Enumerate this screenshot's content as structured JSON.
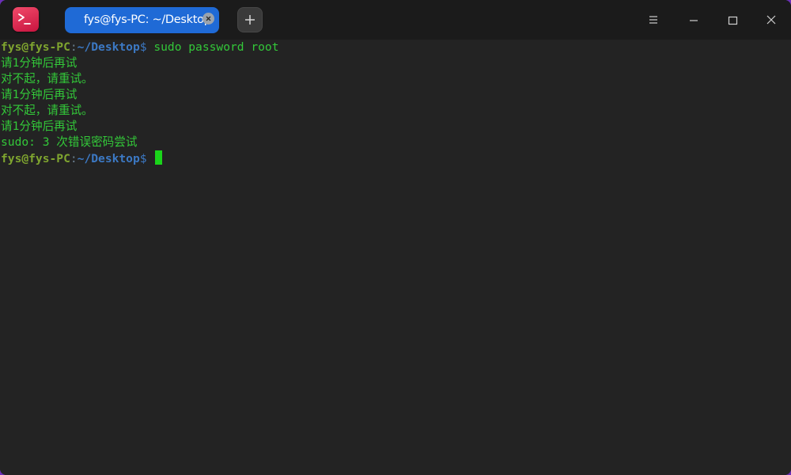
{
  "titlebar": {
    "app_icon": "terminal-icon",
    "tab": {
      "label": "fys@fys-PC: ~/Desktop",
      "close_icon": "close-icon"
    },
    "add_tab_icon": "plus-icon",
    "menu_icon": "hamburger-menu-icon",
    "minimize_icon": "minimize-icon",
    "maximize_icon": "maximize-icon",
    "close_icon": "close-icon"
  },
  "terminal": {
    "prompt1": {
      "user": "fys@fys-PC",
      "sep": ":",
      "path": "~/Desktop",
      "dollar": "$",
      "command": " sudo password root"
    },
    "output": [
      "请1分钟后再试",
      "对不起，请重试。",
      "请1分钟后再试",
      "对不起，请重试。",
      "请1分钟后再试",
      "sudo: 3 次错误密码尝试"
    ],
    "prompt2": {
      "user": "fys@fys-PC",
      "sep": ":",
      "path": "~/Desktop",
      "dollar": "$",
      "command": " "
    }
  },
  "colors": {
    "user": "#7fa52f",
    "path": "#3c79c4",
    "output": "#33c839",
    "tab_active": "#1f6ad6",
    "background": "#232323"
  }
}
